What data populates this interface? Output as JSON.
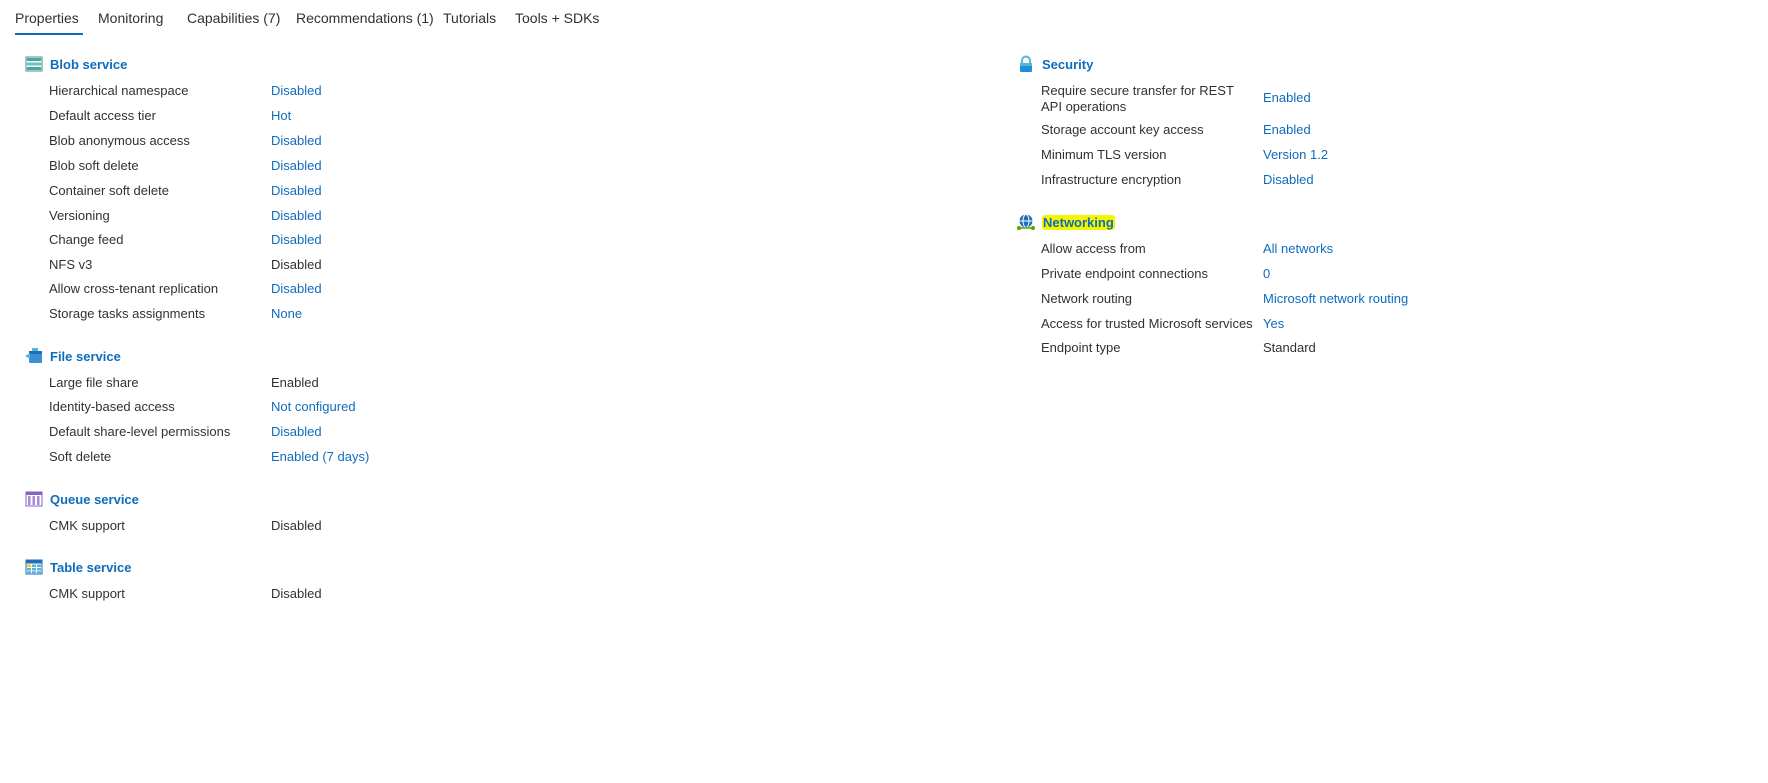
{
  "tabs": [
    {
      "label": "Properties"
    },
    {
      "label": "Monitoring"
    },
    {
      "label": "Capabilities (7)"
    },
    {
      "label": "Recommendations (1)"
    },
    {
      "label": "Tutorials"
    },
    {
      "label": "Tools + SDKs"
    }
  ],
  "blob": {
    "title": "Blob service",
    "rows": [
      {
        "label": "Hierarchical namespace",
        "value": "Disabled"
      },
      {
        "label": "Default access tier",
        "value": "Hot"
      },
      {
        "label": "Blob anonymous access",
        "value": "Disabled"
      },
      {
        "label": "Blob soft delete",
        "value": "Disabled"
      },
      {
        "label": "Container soft delete",
        "value": "Disabled"
      },
      {
        "label": "Versioning",
        "value": "Disabled"
      },
      {
        "label": "Change feed",
        "value": "Disabled"
      },
      {
        "label": "NFS v3",
        "value": "Disabled"
      },
      {
        "label": "Allow cross-tenant replication",
        "value": "Disabled"
      },
      {
        "label": "Storage tasks assignments",
        "value": "None"
      }
    ]
  },
  "file": {
    "title": "File service",
    "rows": [
      {
        "label": "Large file share",
        "value": "Enabled"
      },
      {
        "label": "Identity-based access",
        "value": "Not configured"
      },
      {
        "label": "Default share-level permissions",
        "value": "Disabled"
      },
      {
        "label": "Soft delete",
        "value": "Enabled (7 days)"
      }
    ]
  },
  "queue": {
    "title": "Queue service",
    "rows": [
      {
        "label": "CMK support",
        "value": "Disabled"
      }
    ]
  },
  "table": {
    "title": "Table service",
    "rows": [
      {
        "label": "CMK support",
        "value": "Disabled"
      }
    ]
  },
  "security": {
    "title": "Security",
    "rows": [
      {
        "label": "Require secure transfer for REST API operations",
        "value": "Enabled"
      },
      {
        "label": "Storage account key access",
        "value": "Enabled"
      },
      {
        "label": "Minimum TLS version",
        "value": "Version 1.2"
      },
      {
        "label": "Infrastructure encryption",
        "value": "Disabled"
      }
    ]
  },
  "networking": {
    "title": "Networking",
    "rows": [
      {
        "label": "Allow access from",
        "value": "All networks"
      },
      {
        "label": "Private endpoint connections",
        "value": "0"
      },
      {
        "label": "Network routing",
        "value": "Microsoft network routing"
      },
      {
        "label": "Access for trusted Microsoft services",
        "value": "Yes"
      },
      {
        "label": "Endpoint type",
        "value": "Standard"
      }
    ]
  },
  "colors": {
    "link": "#0f6cbd",
    "text": "#323130",
    "highlight": "#f5f500"
  },
  "icons": {
    "blob": "blob-storage-icon",
    "file": "file-share-icon",
    "queue": "queue-icon",
    "table": "table-icon",
    "security": "lock-icon",
    "networking": "globe-network-icon"
  }
}
